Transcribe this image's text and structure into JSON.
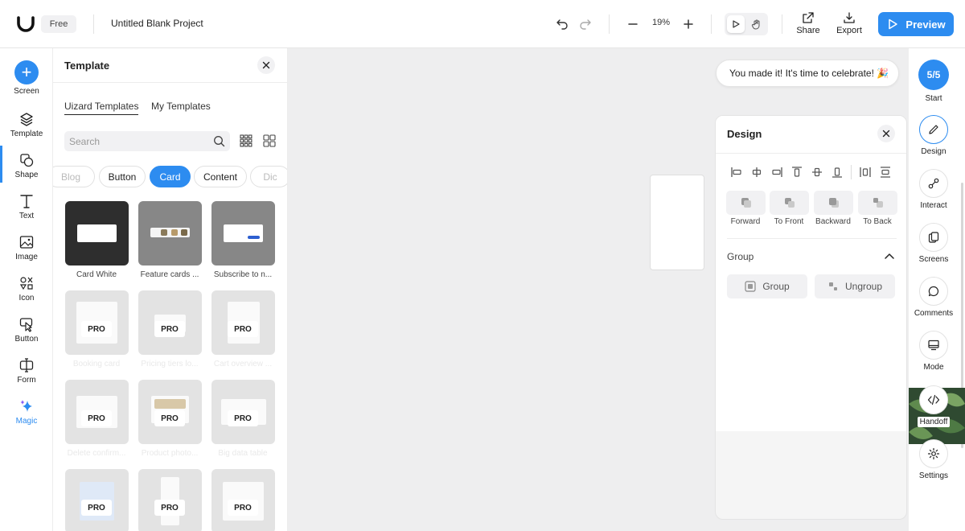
{
  "header": {
    "plan_badge": "Free",
    "project_title": "Untitled Blank Project",
    "zoom": "19%",
    "share_label": "Share",
    "export_label": "Export",
    "preview_label": "Preview"
  },
  "left_rail": {
    "items": [
      {
        "label": "Screen",
        "icon": "plus-icon"
      },
      {
        "label": "Template",
        "icon": "layers-icon"
      },
      {
        "label": "Shape",
        "icon": "shape-icon"
      },
      {
        "label": "Text",
        "icon": "text-icon"
      },
      {
        "label": "Image",
        "icon": "image-icon"
      },
      {
        "label": "Icon",
        "icon": "icon-set-icon"
      },
      {
        "label": "Button",
        "icon": "cursor-click-icon"
      },
      {
        "label": "Form",
        "icon": "form-icon"
      },
      {
        "label": "Magic",
        "icon": "sparkle-icon"
      }
    ]
  },
  "template_panel": {
    "title": "Template",
    "tabs": [
      "Uizard Templates",
      "My Templates"
    ],
    "search_placeholder": "Search",
    "chips": [
      "Blog",
      "Button",
      "Card",
      "Content",
      "Dic"
    ],
    "active_chip": "Card",
    "cards": [
      {
        "label": "Card White",
        "pro": false
      },
      {
        "label": "Feature cards ...",
        "pro": false
      },
      {
        "label": "Subscribe to n...",
        "pro": false
      },
      {
        "label": "Booking card",
        "pro": true,
        "badge": "PRO"
      },
      {
        "label": "Pricing tiers lo...",
        "pro": true,
        "badge": "PRO"
      },
      {
        "label": "Cart overview ...",
        "pro": true,
        "badge": "PRO"
      },
      {
        "label": "Delete confirm...",
        "pro": true,
        "badge": "PRO"
      },
      {
        "label": "Product photo...",
        "pro": true,
        "badge": "PRO"
      },
      {
        "label": "Big data table",
        "pro": true,
        "badge": "PRO"
      },
      {
        "label": "",
        "pro": true,
        "badge": "PRO"
      },
      {
        "label": "",
        "pro": true,
        "badge": "PRO"
      },
      {
        "label": "",
        "pro": true,
        "badge": "PRO"
      }
    ]
  },
  "toast": {
    "message": "You made it! It's time to celebrate! 🎉"
  },
  "design_panel": {
    "title": "Design",
    "order_buttons": [
      "Forward",
      "To Front",
      "Backward",
      "To Back"
    ],
    "group_section_title": "Group",
    "group_label": "Group",
    "ungroup_label": "Ungroup"
  },
  "right_rail": {
    "step": "5/5",
    "items": [
      "Start",
      "Design",
      "Interact",
      "Screens",
      "Comments",
      "Mode",
      "Handoff",
      "Settings"
    ]
  },
  "colors": {
    "accent": "#2d8cf0",
    "canvas": "#eeeeef"
  }
}
